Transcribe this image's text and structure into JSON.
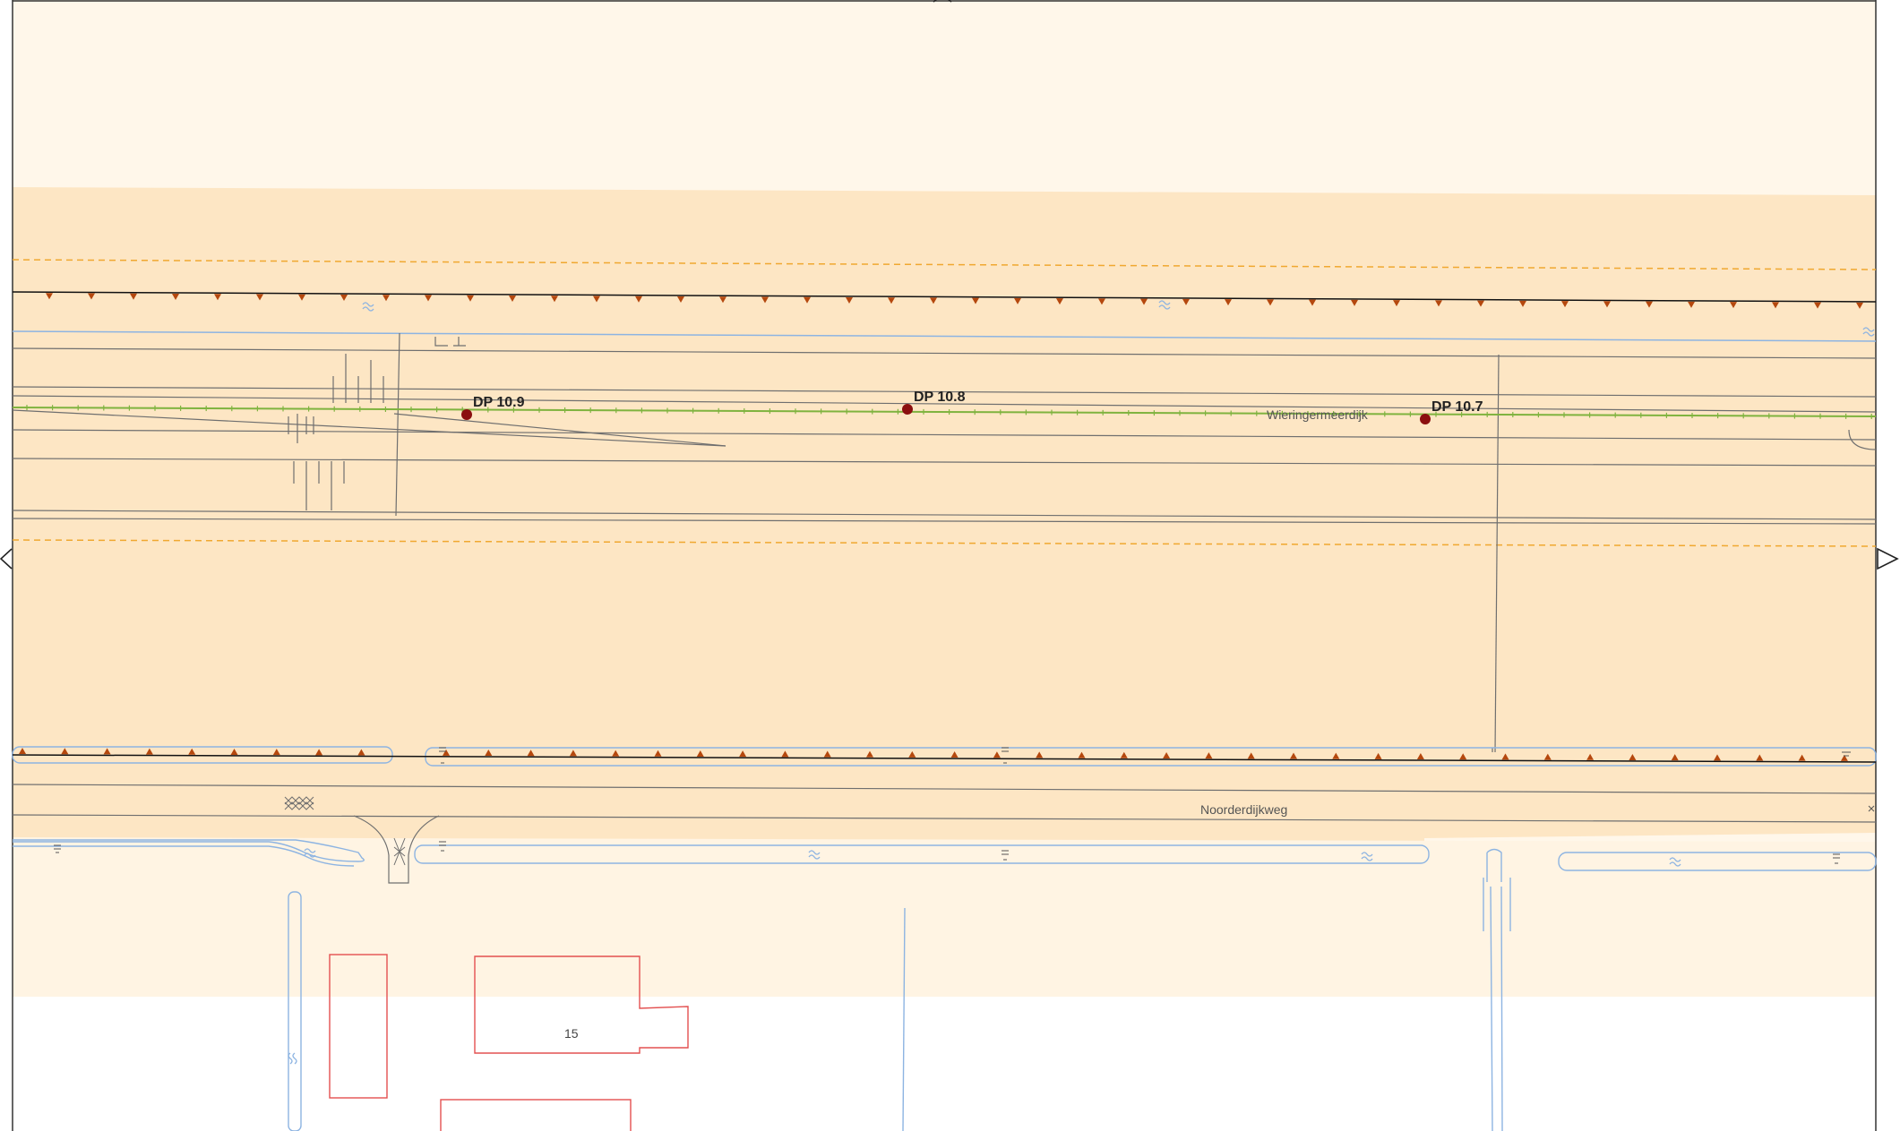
{
  "map": {
    "colors": {
      "zone_light": "#fff7ea",
      "zone_dike": "#fde6c4",
      "line_grey": "#6f6f6f",
      "water_blue": "#8db4e2",
      "building_red": "#e35050",
      "dike_green": "#7fb33f",
      "marker_red": "#8b0f0f",
      "triangle_brown": "#b5480e",
      "dashed_orange": "#f0a830",
      "nav_arrow": "#222222"
    },
    "markers": [
      {
        "label": "DP 10.9"
      },
      {
        "label": "DP 10.8"
      },
      {
        "label": "DP 10.7"
      }
    ],
    "roads": {
      "dike_road": "Wieringermeerdijk",
      "lower_road": "Noorderdijkweg"
    },
    "buildings": {
      "house_number": "15"
    },
    "icons": {
      "water": "water-wave-icon",
      "nav_left": "pan-left-arrow-icon",
      "nav_right": "pan-right-arrow-icon",
      "nav_up": "pan-up-arrow-icon",
      "culvert": "culvert-icon",
      "fence": "fence-icon"
    }
  }
}
